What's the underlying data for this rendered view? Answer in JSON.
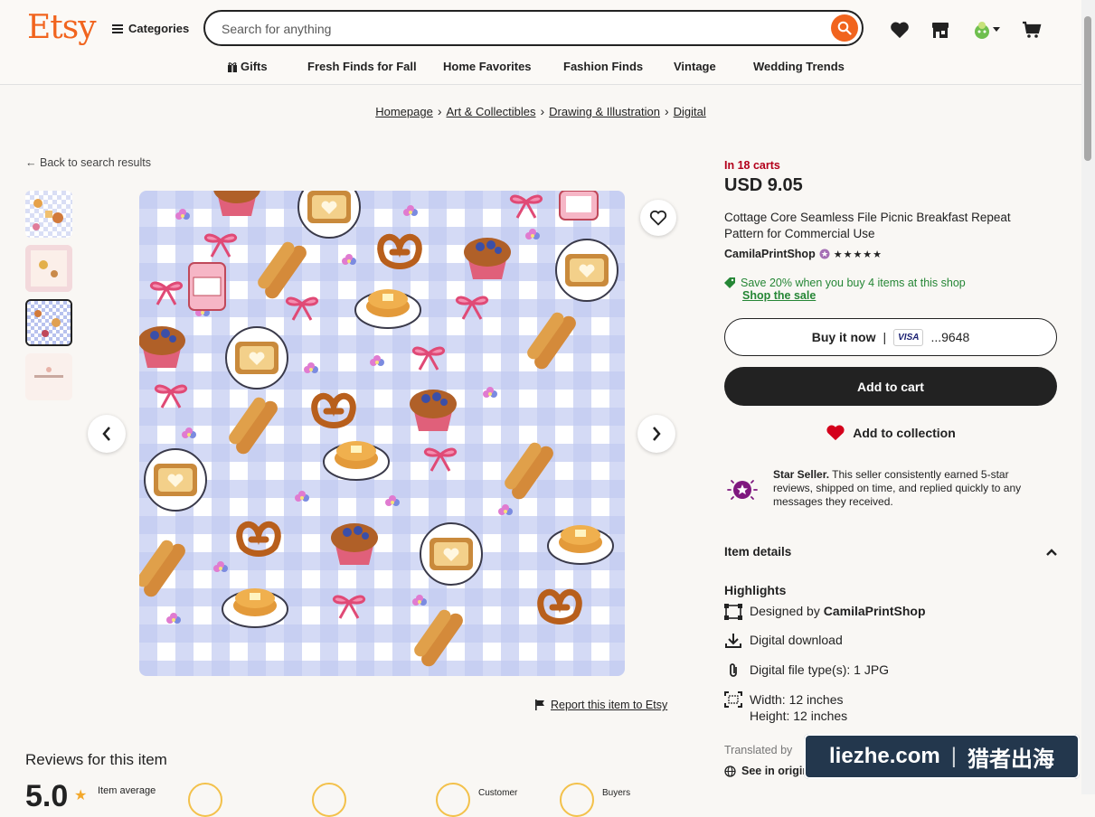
{
  "header": {
    "logo": "Etsy",
    "categories_label": "Categories",
    "search_placeholder": "Search for anything",
    "nav": [
      "Gifts",
      "Fresh Finds for Fall",
      "Home Favorites",
      "Fashion Finds",
      "Vintage",
      "Wedding Trends"
    ]
  },
  "breadcrumb": [
    "Homepage",
    "Art & Collectibles",
    "Drawing & Illustration",
    "Digital"
  ],
  "back_link": "Back to search results",
  "report_link": "Report this item to Etsy",
  "product": {
    "cart_notice": "In 18 carts",
    "price": "USD 9.05",
    "title": "Cottage Core Seamless File Picnic Breakfast Repeat Pattern for Commercial Use",
    "shop": "CamilaPrintShop",
    "rating_stars": "★★★★★",
    "promo": "Save 20% when you buy 4 items at this shop",
    "promo_link": "Shop the sale",
    "buy_now": "Buy it now",
    "card_brand": "VISA",
    "card_digits": "...9648",
    "add_to_cart": "Add to cart",
    "add_to_collection": "Add to collection",
    "star_seller_title": "Star Seller.",
    "star_seller_text": "This seller consistently earned 5-star reviews, shipped on time, and replied quickly to any messages they received."
  },
  "item_details": {
    "heading": "Item details",
    "highlights_label": "Highlights",
    "designed_by_prefix": "Designed by",
    "designer": "CamilaPrintShop",
    "digital_download": "Digital download",
    "file_types": "Digital file type(s): 1 JPG",
    "width": "Width: 12 inches",
    "height": "Height: 12 inches",
    "translated": "Translated by",
    "see_original": "See in original language"
  },
  "reviews": {
    "title": "Reviews for this item",
    "score": "5.0",
    "item_average": "Item average",
    "customer": "Customer",
    "buyers": "Buyers"
  },
  "watermark": {
    "left": "liezhe.com",
    "right": "猎者出海"
  },
  "colors": {
    "brand": "#f1641e",
    "cart_red": "#b3001b",
    "promo_green": "#258635",
    "star_purple": "#7f187f",
    "heart_red": "#d4001b"
  }
}
